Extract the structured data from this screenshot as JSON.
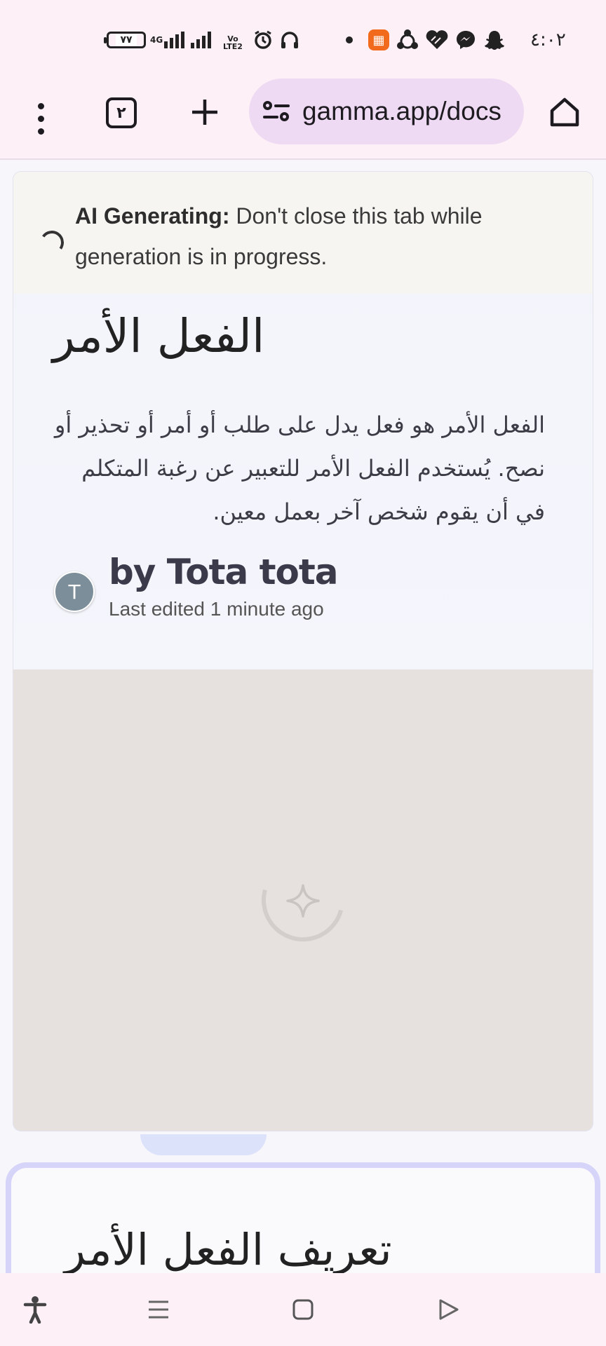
{
  "status_bar": {
    "battery": "٧٧",
    "network": "4G",
    "volte": "VoLTE2",
    "clock": "٤:٠٢",
    "icons": [
      "battery-icon",
      "signal-4g-icon",
      "signal-icon",
      "volte-icon",
      "alarm-icon",
      "headphones-icon",
      "notification-dot",
      "app-orange-icon",
      "sync-icon",
      "heart-icon",
      "messenger-icon",
      "snapchat-icon"
    ]
  },
  "browser": {
    "tab_count": "٢",
    "url": "gamma.app/docs"
  },
  "banner": {
    "bold": "AI Generating:",
    "text": " Don't close this tab while generation is in progress."
  },
  "doc": {
    "title": "الفعل الأمر",
    "description": "الفعل الأمر هو فعل يدل على طلب أو أمر أو تحذير أو نصح. يُستخدم الفعل الأمر للتعبير عن رغبة المتكلم في أن يقوم شخص آخر بعمل معين.",
    "author_initial": "T",
    "author": "by Tota tota",
    "last_edited": "Last edited 1 minute ago"
  },
  "next_card": {
    "title": "تعريف الفعل الأمر"
  },
  "nav": {
    "icons": [
      "accessibility-icon",
      "recents-icon",
      "home-square-icon",
      "back-triangle-icon"
    ]
  }
}
